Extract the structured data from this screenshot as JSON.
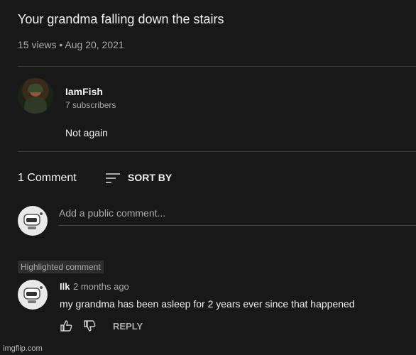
{
  "video": {
    "title": "Your grandma falling down the stairs",
    "views": "15 views",
    "separator": "•",
    "date": "Aug 20, 2021"
  },
  "channel": {
    "name": "IamFish",
    "subscribers": "7 subscribers",
    "description": "Not again",
    "avatar_icon": "soldier-avatar-icon"
  },
  "comments": {
    "count_label": "1 Comment",
    "sort_label": "SORT BY",
    "sort_icon": "sort-lines-icon",
    "input_placeholder": "Add a public comment...",
    "highlighted_badge": "Highlighted comment",
    "items": [
      {
        "author": "Ilk",
        "time": "2 months ago",
        "text": "my grandma has been asleep for 2 years ever since that happened",
        "reply_label": "REPLY"
      }
    ]
  },
  "watermark": "imgflip.com",
  "colors": {
    "background": "#181818",
    "text": "#f1f1f1",
    "secondary_text": "#aaaaaa",
    "divider": "#3a3a3a"
  }
}
